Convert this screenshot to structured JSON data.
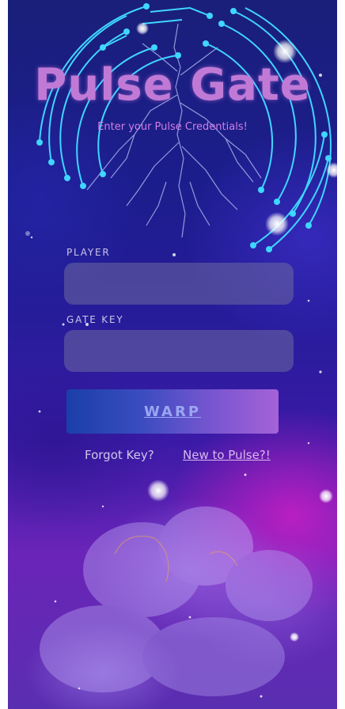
{
  "app": {
    "title": "Pulse Gate",
    "subtitle": "Enter your Pulse Credentials!"
  },
  "form": {
    "player_label": "PLAYER",
    "player_value": "",
    "gatekey_label": "GATE KEY",
    "gatekey_value": "",
    "submit_label": "WARP"
  },
  "links": {
    "forgot": "Forgot Key?",
    "signup": "New to Pulse?!"
  },
  "colors": {
    "title": "#c07ad6",
    "circuit": "#3fd6ff",
    "button_start": "#1a3fa8",
    "button_end": "#a662d8"
  },
  "icons": {
    "header_art": "circuit-lightning-icon"
  }
}
